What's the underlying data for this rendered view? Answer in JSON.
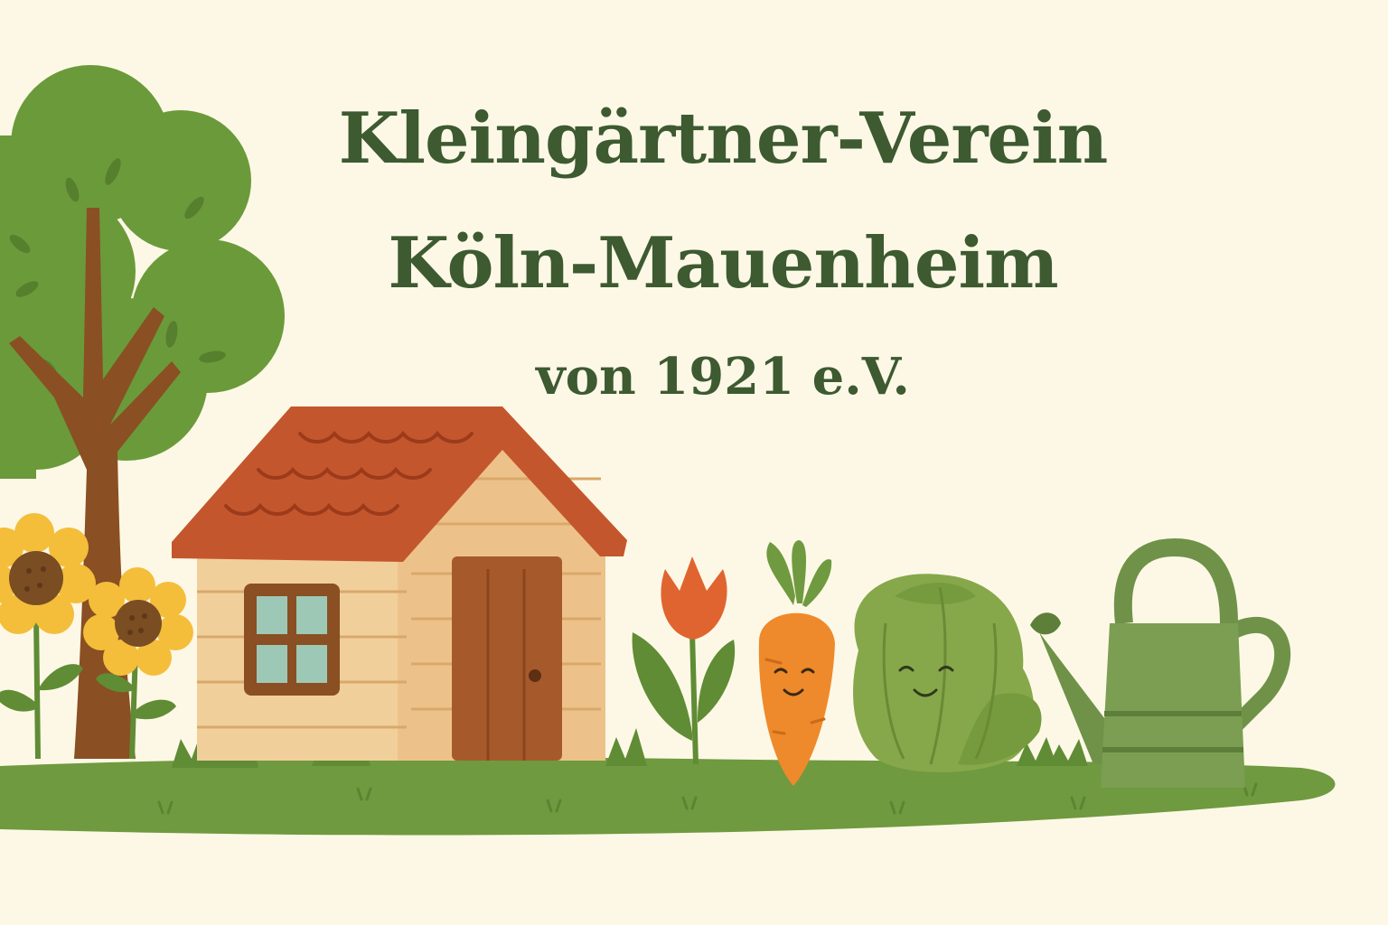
{
  "title": {
    "line1": "Kleingärtner-Verein",
    "line2": "Köln-Mauenheim",
    "line3": "von 1921 e.V."
  },
  "colors": {
    "background": "#fdf8e6",
    "title_text": "#3d5a31",
    "grass": "#6f9a3f",
    "tree_foliage": "#6b9a3a",
    "tree_trunk": "#8a4f22",
    "roof": "#c4562d",
    "shed_wall": "#f1cf9b",
    "door": "#a65a2b",
    "window_glass": "#9ec8b6",
    "sunflower_petal": "#f4be3a",
    "sunflower_center": "#7a4d23",
    "tulip": "#e0642f",
    "carrot": "#ee8a2b",
    "cabbage": "#86a84a",
    "watering_can": "#6f9248"
  },
  "icons": [
    "tree-icon",
    "sunflower-icon",
    "garden-shed-icon",
    "tulip-icon",
    "carrot-icon",
    "cabbage-icon",
    "watering-can-icon",
    "grass-tuft-icon"
  ]
}
